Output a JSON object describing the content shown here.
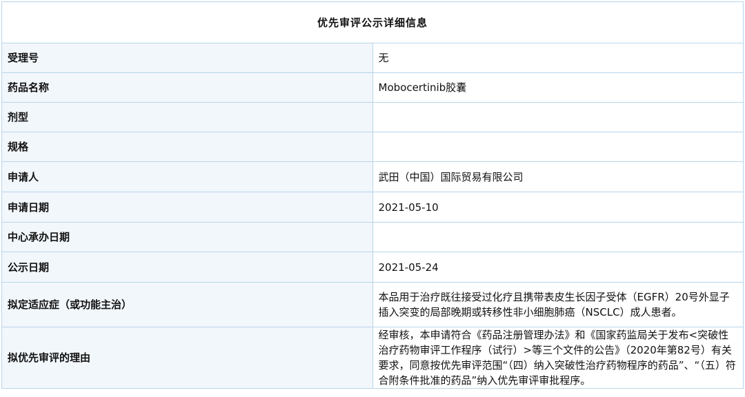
{
  "title": "优先审评公示详细信息",
  "rows": [
    {
      "label": "受理号",
      "value": "无"
    },
    {
      "label": "药品名称",
      "value": "Mobocertinib胶囊"
    },
    {
      "label": "剂型",
      "value": ""
    },
    {
      "label": "规格",
      "value": ""
    },
    {
      "label": "申请人",
      "value": "武田（中国）国际贸易有限公司"
    },
    {
      "label": "申请日期",
      "value": "2021-05-10"
    },
    {
      "label": "中心承办日期",
      "value": ""
    },
    {
      "label": "公示日期",
      "value": "2021-05-24"
    },
    {
      "label": "拟定适应症（或功能主治）",
      "value": "本品用于治疗既往接受过化疗且携带表皮生长因子受体（EGFR）20号外显子插入突变的局部晚期或转移性非小细胞肺癌（NSCLC）成人患者。"
    },
    {
      "label": "拟优先审评的理由",
      "value": "经审核，本申请符合《药品注册管理办法》和《国家药监局关于发布<突破性治疗药物审评工作程序（试行）>等三个文件的公告》（2020年第82号）有关要求，同意按优先审评范围“（四）纳入突破性治疗药物程序的药品”、“（五）符合附条件批准的药品”纳入优先审评审批程序。"
    }
  ]
}
